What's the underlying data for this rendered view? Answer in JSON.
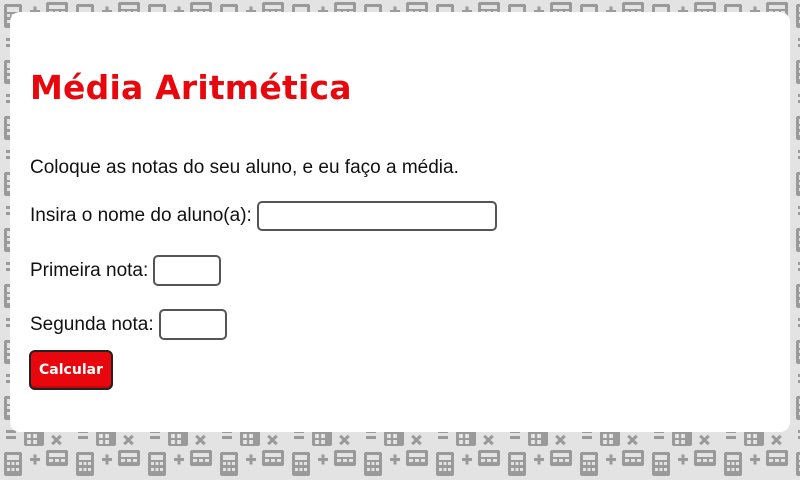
{
  "page": {
    "title": "Média Aritmética",
    "intro": "Coloque as notas do seu aluno, e eu faço a média."
  },
  "form": {
    "name_label": "Insira o nome do aluno(a):",
    "name_value": "",
    "nota1_label": "Primeira nota:",
    "nota1_value": "",
    "nota2_label": "Segunda nota:",
    "nota2_value": "",
    "submit_label": "Calcular"
  },
  "colors": {
    "accent": "#e8070d",
    "background": "#e3e3e3",
    "pattern": "#9a9a9a",
    "card": "#ffffff",
    "text": "#111111"
  },
  "icons": {
    "background": "calculator-pattern"
  }
}
